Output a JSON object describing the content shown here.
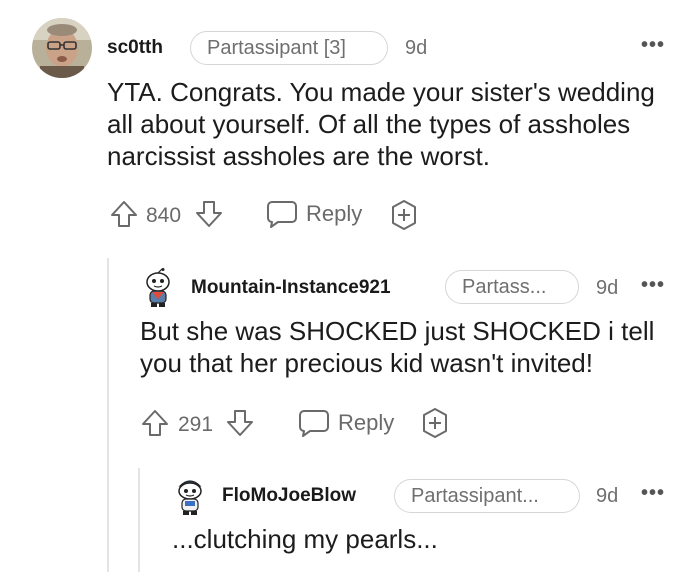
{
  "comments": [
    {
      "username": "sc0tth",
      "flair": "Partassipant [3]",
      "age": "9d",
      "body": "YTA. Congrats. You made your sister's wedding all about yourself. Of all the types of assholes narcissist assholes are the worst.",
      "votes": "840",
      "reply_label": "Reply"
    },
    {
      "username": "Mountain-Instance921",
      "flair": "Partass...",
      "age": "9d",
      "body": "But she was SHOCKED just SHOCKED i tell you that her precious kid wasn't invited!",
      "votes": "291",
      "reply_label": "Reply"
    },
    {
      "username": "FloMoJoeBlow",
      "flair": "Partassipant...",
      "age": "9d",
      "body": "...clutching my pearls..."
    }
  ],
  "more_icon_glyph": "•••",
  "colors": {
    "text": "#1c1c1c",
    "muted": "#6f6f6f",
    "border": "#d6d6d6"
  }
}
